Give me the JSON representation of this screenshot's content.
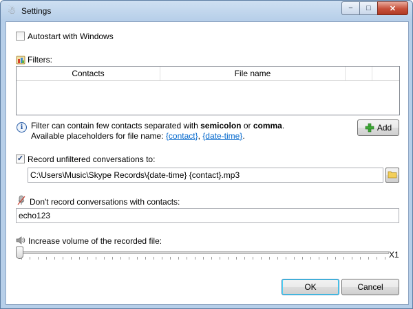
{
  "window": {
    "title": "Settings",
    "icon": "app-icon"
  },
  "caption": {
    "minimize": "−",
    "maximize": "□",
    "close": "✕"
  },
  "autostart": {
    "label": "Autostart with Windows",
    "checked": false
  },
  "filters": {
    "label": "Filters:",
    "columns": [
      "Contacts",
      "File name"
    ],
    "rows": []
  },
  "info": {
    "line1_prefix": "Filter can contain few contacts separated with ",
    "word1": "semicolon",
    "or": " or ",
    "word2": "comma",
    "period": ".",
    "line2_prefix": "Available placeholders for file name: ",
    "placeholder1": "{contact}",
    "sep": ", ",
    "placeholder2": "{date-time}",
    "end": "."
  },
  "add_button": {
    "label": "Add"
  },
  "record_unfiltered": {
    "label": "Record unfiltered conversations to:",
    "checked": true,
    "path": "C:\\Users\\Music\\Skype Records\\{date-time} {contact}.mp3"
  },
  "dont_record": {
    "label": "Don't record conversations with contacts:",
    "value": "echo123"
  },
  "volume": {
    "label": "Increase volume of the recorded file:",
    "value_label": "X1",
    "level": 0
  },
  "buttons": {
    "ok": "OK",
    "cancel": "Cancel"
  },
  "colors": {
    "link": "#0066cc",
    "add_icon": "#3da836",
    "folder_icon": "#e8b830"
  }
}
